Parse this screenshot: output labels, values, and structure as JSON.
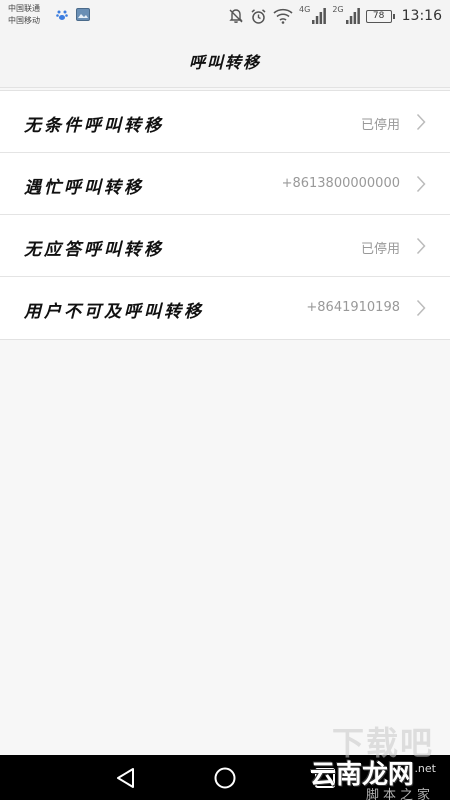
{
  "status_bar": {
    "carrier_1": "中国联通",
    "carrier_2": "中国移动",
    "network_1": "4G",
    "network_2": "2G",
    "battery": "78",
    "time": "13:16"
  },
  "header": {
    "title": "呼叫转移"
  },
  "settings": {
    "items": [
      {
        "label": "无条件呼叫转移",
        "value": "已停用"
      },
      {
        "label": "遇忙呼叫转移",
        "value": "+8613800000000"
      },
      {
        "label": "无应答呼叫转移",
        "value": "已停用"
      },
      {
        "label": "用户不可及呼叫转移",
        "value": "+8641910198"
      }
    ]
  },
  "watermark": {
    "ghost_text": "下载吧",
    "brand": "云南龙网",
    "suffix": ".net",
    "sub": "脚本之家"
  },
  "colors": {
    "background": "#f7f7f7",
    "list_background": "#ffffff",
    "secondary_text": "#999999",
    "nav_bar": "#000000"
  }
}
